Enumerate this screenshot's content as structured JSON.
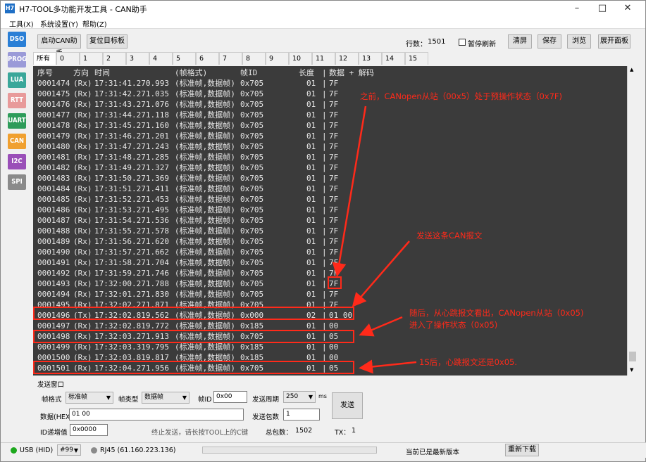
{
  "window": {
    "title": "H7-TOOL多功能开发工具 - CAN助手",
    "logo": "H7"
  },
  "menu": [
    "工具(X)",
    "系统设置(Y)",
    "帮助(Z)"
  ],
  "sidebar": [
    {
      "label": "DSO",
      "color": "#2a7fd6"
    },
    {
      "label": "PROG",
      "color": "#9a9ad8"
    },
    {
      "label": "LUA",
      "color": "#3aa79a"
    },
    {
      "label": "RTT",
      "color": "#e89a9a"
    },
    {
      "label": "UART",
      "color": "#2e9c5a"
    },
    {
      "label": "CAN",
      "color": "#f0a030"
    },
    {
      "label": "I2C",
      "color": "#9a4fb8"
    },
    {
      "label": "SPI",
      "color": "#8a8a8a"
    }
  ],
  "toolbar": {
    "start_can": "启动CAN助手",
    "reset_target": "复位目标板",
    "row_count_label": "行数：",
    "row_count": "1501",
    "pause_refresh": "暂停刷新",
    "clear": "清屏",
    "save": "保存",
    "browse": "浏览",
    "expand_panel": "展开面板"
  },
  "tabs": [
    "所有包",
    "0",
    "1",
    "2",
    "3",
    "4",
    "5",
    "6",
    "7",
    "8",
    "9",
    "10",
    "11",
    "12",
    "13",
    "14",
    "15"
  ],
  "console": {
    "header": {
      "seq": "序号",
      "dir": "方向",
      "time": "时间",
      "fmt": "(帧格式)",
      "id": "帧ID",
      "len": "长度",
      "sep": "|",
      "data": "数据 + 解码"
    },
    "rows": [
      {
        "seq": "0001474",
        "dir": "(Rx)",
        "time": "17:31:41.270.993",
        "fmt": "(标准帧,数据帧)",
        "id": "0x705",
        "len": "01",
        "data": "7F"
      },
      {
        "seq": "0001475",
        "dir": "(Rx)",
        "time": "17:31:42.271.035",
        "fmt": "(标准帧,数据帧)",
        "id": "0x705",
        "len": "01",
        "data": "7F"
      },
      {
        "seq": "0001476",
        "dir": "(Rx)",
        "time": "17:31:43.271.076",
        "fmt": "(标准帧,数据帧)",
        "id": "0x705",
        "len": "01",
        "data": "7F"
      },
      {
        "seq": "0001477",
        "dir": "(Rx)",
        "time": "17:31:44.271.118",
        "fmt": "(标准帧,数据帧)",
        "id": "0x705",
        "len": "01",
        "data": "7F"
      },
      {
        "seq": "0001478",
        "dir": "(Rx)",
        "time": "17:31:45.271.160",
        "fmt": "(标准帧,数据帧)",
        "id": "0x705",
        "len": "01",
        "data": "7F"
      },
      {
        "seq": "0001479",
        "dir": "(Rx)",
        "time": "17:31:46.271.201",
        "fmt": "(标准帧,数据帧)",
        "id": "0x705",
        "len": "01",
        "data": "7F"
      },
      {
        "seq": "0001480",
        "dir": "(Rx)",
        "time": "17:31:47.271.243",
        "fmt": "(标准帧,数据帧)",
        "id": "0x705",
        "len": "01",
        "data": "7F"
      },
      {
        "seq": "0001481",
        "dir": "(Rx)",
        "time": "17:31:48.271.285",
        "fmt": "(标准帧,数据帧)",
        "id": "0x705",
        "len": "01",
        "data": "7F"
      },
      {
        "seq": "0001482",
        "dir": "(Rx)",
        "time": "17:31:49.271.327",
        "fmt": "(标准帧,数据帧)",
        "id": "0x705",
        "len": "01",
        "data": "7F"
      },
      {
        "seq": "0001483",
        "dir": "(Rx)",
        "time": "17:31:50.271.369",
        "fmt": "(标准帧,数据帧)",
        "id": "0x705",
        "len": "01",
        "data": "7F"
      },
      {
        "seq": "0001484",
        "dir": "(Rx)",
        "time": "17:31:51.271.411",
        "fmt": "(标准帧,数据帧)",
        "id": "0x705",
        "len": "01",
        "data": "7F"
      },
      {
        "seq": "0001485",
        "dir": "(Rx)",
        "time": "17:31:52.271.453",
        "fmt": "(标准帧,数据帧)",
        "id": "0x705",
        "len": "01",
        "data": "7F"
      },
      {
        "seq": "0001486",
        "dir": "(Rx)",
        "time": "17:31:53.271.495",
        "fmt": "(标准帧,数据帧)",
        "id": "0x705",
        "len": "01",
        "data": "7F"
      },
      {
        "seq": "0001487",
        "dir": "(Rx)",
        "time": "17:31:54.271.536",
        "fmt": "(标准帧,数据帧)",
        "id": "0x705",
        "len": "01",
        "data": "7F"
      },
      {
        "seq": "0001488",
        "dir": "(Rx)",
        "time": "17:31:55.271.578",
        "fmt": "(标准帧,数据帧)",
        "id": "0x705",
        "len": "01",
        "data": "7F"
      },
      {
        "seq": "0001489",
        "dir": "(Rx)",
        "time": "17:31:56.271.620",
        "fmt": "(标准帧,数据帧)",
        "id": "0x705",
        "len": "01",
        "data": "7F"
      },
      {
        "seq": "0001490",
        "dir": "(Rx)",
        "time": "17:31:57.271.662",
        "fmt": "(标准帧,数据帧)",
        "id": "0x705",
        "len": "01",
        "data": "7F"
      },
      {
        "seq": "0001491",
        "dir": "(Rx)",
        "time": "17:31:58.271.704",
        "fmt": "(标准帧,数据帧)",
        "id": "0x705",
        "len": "01",
        "data": "7F"
      },
      {
        "seq": "0001492",
        "dir": "(Rx)",
        "time": "17:31:59.271.746",
        "fmt": "(标准帧,数据帧)",
        "id": "0x705",
        "len": "01",
        "data": "7F"
      },
      {
        "seq": "0001493",
        "dir": "(Rx)",
        "time": "17:32:00.271.788",
        "fmt": "(标准帧,数据帧)",
        "id": "0x705",
        "len": "01",
        "data": "7F"
      },
      {
        "seq": "0001494",
        "dir": "(Rx)",
        "time": "17:32:01.271.830",
        "fmt": "(标准帧,数据帧)",
        "id": "0x705",
        "len": "01",
        "data": "7F"
      },
      {
        "seq": "0001495",
        "dir": "(Rx)",
        "time": "17:32:02.271.871",
        "fmt": "(标准帧,数据帧)",
        "id": "0x705",
        "len": "01",
        "data": "7F"
      },
      {
        "seq": "0001496",
        "dir": "(Tx)",
        "time": "17:32:02.819.562",
        "fmt": "(标准帧,数据帧)",
        "id": "0x000",
        "len": "02",
        "data": "01 00"
      },
      {
        "seq": "0001497",
        "dir": "(Rx)",
        "time": "17:32:02.819.772",
        "fmt": "(标准帧,数据帧)",
        "id": "0x185",
        "len": "01",
        "data": "00"
      },
      {
        "seq": "0001498",
        "dir": "(Rx)",
        "time": "17:32:03.271.913",
        "fmt": "(标准帧,数据帧)",
        "id": "0x705",
        "len": "01",
        "data": "05"
      },
      {
        "seq": "0001499",
        "dir": "(Rx)",
        "time": "17:32:03.319.795",
        "fmt": "(标准帧,数据帧)",
        "id": "0x185",
        "len": "01",
        "data": "00"
      },
      {
        "seq": "0001500",
        "dir": "(Rx)",
        "time": "17:32:03.819.817",
        "fmt": "(标准帧,数据帧)",
        "id": "0x185",
        "len": "01",
        "data": "00"
      },
      {
        "seq": "0001501",
        "dir": "(Rx)",
        "time": "17:32:04.271.956",
        "fmt": "(标准帧,数据帧)",
        "id": "0x705",
        "len": "01",
        "data": "05"
      }
    ]
  },
  "annotations": {
    "a1": "之前，CANopen从站（00x5）处于预操作状态（0x7F)",
    "a2": "发送这条CAN报文",
    "a3": "随后，从心跳报文看出，CANopen从站（0x05)\n进入了操作状态（0x05)",
    "a4": "1S后，心跳报文还是0x05."
  },
  "send": {
    "group_title": "发送窗口",
    "frame_format_label": "帧格式",
    "frame_format_value": "标准帧",
    "frame_type_label": "帧类型",
    "frame_type_value": "数据帧",
    "frame_id_label": "帧ID",
    "frame_id_value": "0x00",
    "period_label": "发送周期",
    "period_value": "250",
    "period_unit": "ms",
    "send_button": "发送",
    "data_label": "数据(HEX)",
    "data_value": "01 00",
    "count_label": "发送包数",
    "count_value": "1",
    "id_inc_label": "ID递增值",
    "id_inc_value": "0x0000",
    "hint": "终止发送，请长按TOOL上的C键",
    "total_label": "总包数：",
    "total_value": "1502",
    "tx_label": "TX：",
    "tx_value": "1"
  },
  "status": {
    "usb": "USB (HID)",
    "device": "#99",
    "rj45": "RJ45 (61.160.223.136)",
    "version_msg": "当前已是最新版本",
    "download": "重新下载"
  }
}
